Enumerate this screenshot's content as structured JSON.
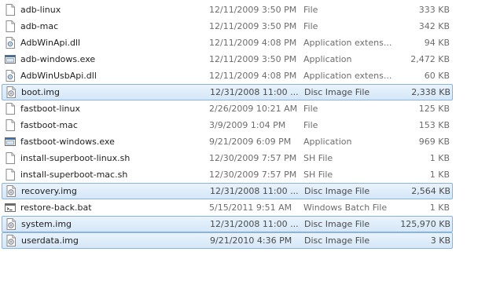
{
  "files": [
    {
      "name": "adb-linux",
      "date": "12/11/2009 3:50 PM",
      "type": "File",
      "size": "333 KB",
      "icon": "blank-file-icon",
      "selected": false
    },
    {
      "name": "adb-mac",
      "date": "12/11/2009 3:50 PM",
      "type": "File",
      "size": "342 KB",
      "icon": "blank-file-icon",
      "selected": false
    },
    {
      "name": "AdbWinApi.dll",
      "date": "12/11/2009 4:08 PM",
      "type": "Application extens...",
      "size": "94 KB",
      "icon": "dll-file-icon",
      "selected": false
    },
    {
      "name": "adb-windows.exe",
      "date": "12/11/2009 3:50 PM",
      "type": "Application",
      "size": "2,472 KB",
      "icon": "exe-file-icon",
      "selected": false
    },
    {
      "name": "AdbWinUsbApi.dll",
      "date": "12/11/2009 4:08 PM",
      "type": "Application extens...",
      "size": "60 KB",
      "icon": "dll-file-icon",
      "selected": false
    },
    {
      "name": "boot.img",
      "date": "12/31/2008 11:00 ...",
      "type": "Disc Image File",
      "size": "2,338 KB",
      "icon": "disc-image-icon",
      "selected": true
    },
    {
      "name": "fastboot-linux",
      "date": "2/26/2009 10:21 AM",
      "type": "File",
      "size": "125 KB",
      "icon": "blank-file-icon",
      "selected": false
    },
    {
      "name": "fastboot-mac",
      "date": "3/9/2009 1:04 PM",
      "type": "File",
      "size": "153 KB",
      "icon": "blank-file-icon",
      "selected": false
    },
    {
      "name": "fastboot-windows.exe",
      "date": "9/21/2009 6:09 PM",
      "type": "Application",
      "size": "969 KB",
      "icon": "exe-file-icon",
      "selected": false
    },
    {
      "name": "install-superboot-linux.sh",
      "date": "12/30/2009 7:57 PM",
      "type": "SH File",
      "size": "1 KB",
      "icon": "blank-file-icon",
      "selected": false
    },
    {
      "name": "install-superboot-mac.sh",
      "date": "12/30/2009 7:57 PM",
      "type": "SH File",
      "size": "1 KB",
      "icon": "blank-file-icon",
      "selected": false
    },
    {
      "name": "recovery.img",
      "date": "12/31/2008 11:00 ...",
      "type": "Disc Image File",
      "size": "2,564 KB",
      "icon": "disc-image-icon",
      "selected": true
    },
    {
      "name": "restore-back.bat",
      "date": "5/15/2011 9:51 AM",
      "type": "Windows Batch File",
      "size": "1 KB",
      "icon": "batch-file-icon",
      "selected": false
    },
    {
      "name": "system.img",
      "date": "12/31/2008 11:00 ...",
      "type": "Disc Image File",
      "size": "125,970 KB",
      "icon": "disc-image-icon",
      "selected": true
    },
    {
      "name": "userdata.img",
      "date": "9/21/2010 4:36 PM",
      "type": "Disc Image File",
      "size": "3 KB",
      "icon": "disc-image-icon",
      "selected": true
    }
  ]
}
